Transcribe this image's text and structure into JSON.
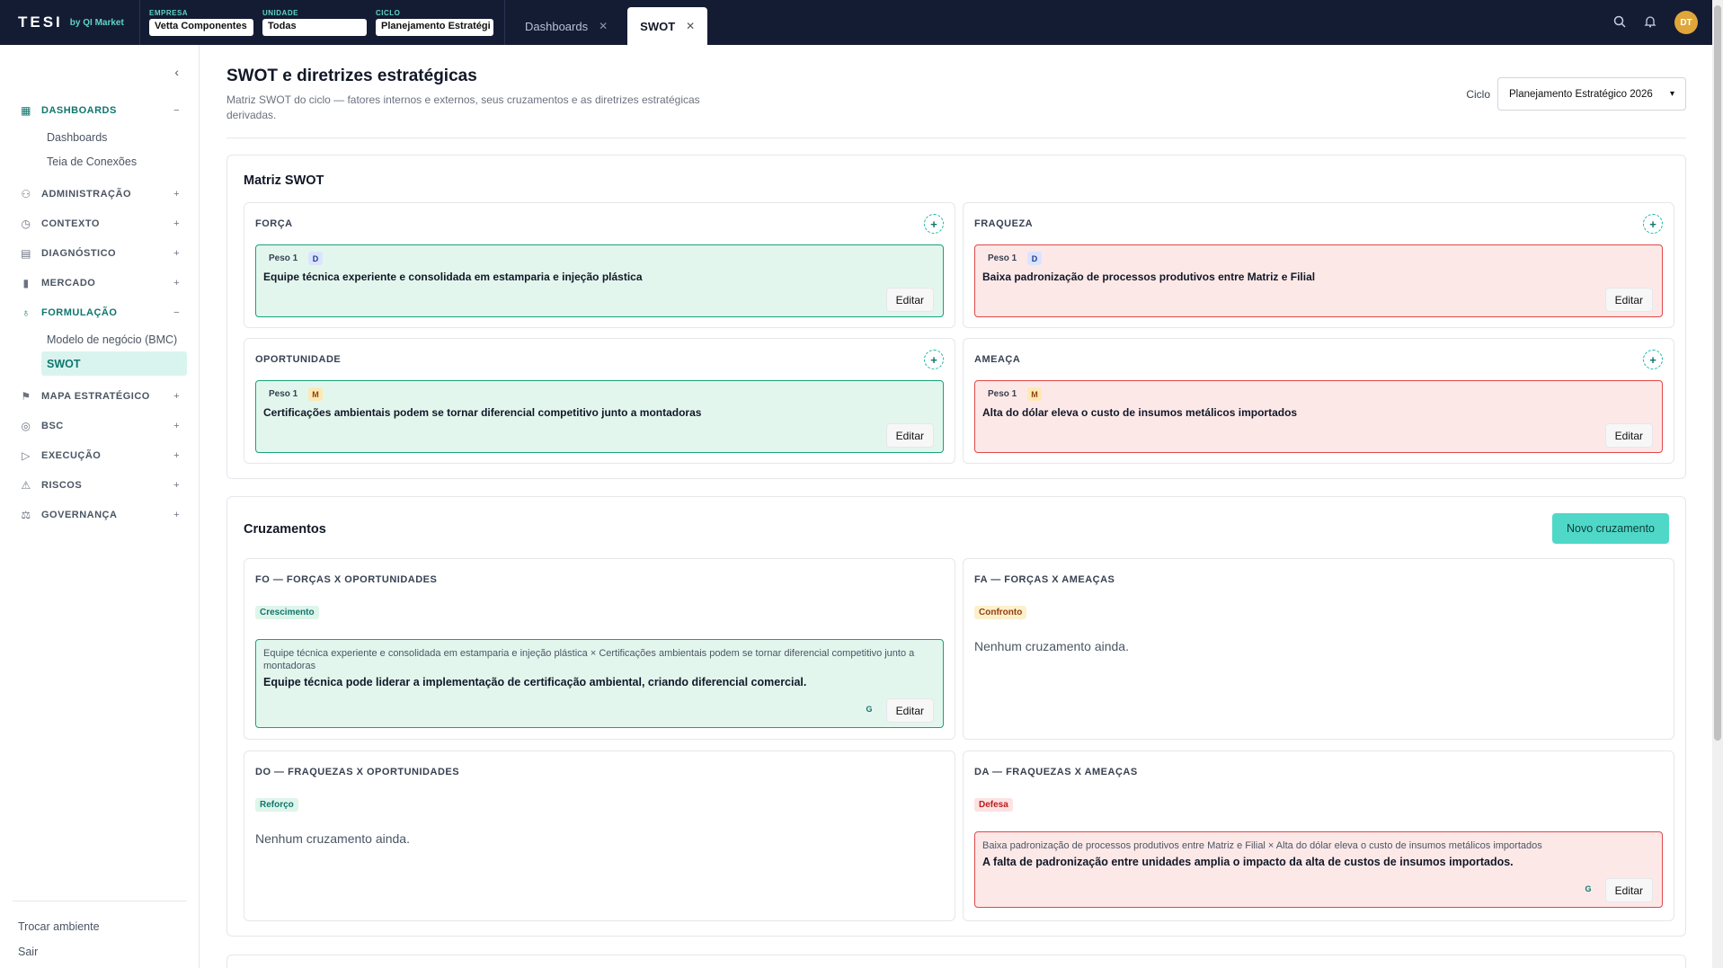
{
  "topbar": {
    "logo": "TESI",
    "logo_sub": "by QI Market",
    "empresa_label": "EMPRESA",
    "empresa_value": "Vetta Componentes",
    "unidade_label": "UNIDADE",
    "unidade_value": "Todas",
    "ciclo_label": "CICLO",
    "ciclo_value": "Planejamento Estratégi",
    "tabs": [
      {
        "label": "Dashboards",
        "active": false
      },
      {
        "label": "SWOT",
        "active": true
      }
    ],
    "avatar": "DT"
  },
  "sidebar": {
    "items": [
      {
        "label": "DASHBOARDS",
        "icon": "dashboard-icon",
        "expanded": true,
        "subitems": [
          "Dashboards",
          "Teia de Conexões"
        ]
      },
      {
        "label": "ADMINISTRAÇÃO",
        "icon": "users-icon",
        "expanded": false
      },
      {
        "label": "CONTEXTO",
        "icon": "compass-icon",
        "expanded": false
      },
      {
        "label": "DIAGNÓSTICO",
        "icon": "clipboard-icon",
        "expanded": false
      },
      {
        "label": "MERCADO",
        "icon": "bar-chart-icon",
        "expanded": false
      },
      {
        "label": "FORMULAÇÃO",
        "icon": "lightbulb-icon",
        "expanded": true,
        "subitems": [
          "Modelo de negócio (BMC)",
          "SWOT"
        ]
      },
      {
        "label": "MAPA ESTRATÉGICO",
        "icon": "flag-icon",
        "expanded": false
      },
      {
        "label": "BSC",
        "icon": "target-icon",
        "expanded": false
      },
      {
        "label": "EXECUÇÃO",
        "icon": "play-icon",
        "expanded": false
      },
      {
        "label": "RISCOS",
        "icon": "warning-icon",
        "expanded": false
      },
      {
        "label": "GOVERNANÇA",
        "icon": "scale-icon",
        "expanded": false
      }
    ],
    "bottom": [
      "Trocar ambiente",
      "Sair"
    ]
  },
  "page": {
    "title": "SWOT e diretrizes estratégicas",
    "description": "Matriz SWOT do ciclo — fatores internos e externos, seus cruzamentos e as diretrizes estratégicas derivadas.",
    "cycle_label": "Ciclo",
    "cycle_value": "Planejamento Estratégico 2026"
  },
  "swot": {
    "title": "Matriz SWOT",
    "quadrants": [
      {
        "title": "FORÇA",
        "peso": "Peso 1",
        "badge": "D",
        "text": "Equipe técnica experiente e consolidada em estamparia e injeção plástica",
        "edit": "Editar"
      },
      {
        "title": "FRAQUEZA",
        "peso": "Peso 1",
        "badge": "D",
        "text": "Baixa padronização de processos produtivos entre Matriz e Filial",
        "edit": "Editar"
      },
      {
        "title": "OPORTUNIDADE",
        "peso": "Peso 1",
        "badge": "M",
        "text": "Certificações ambientais podem se tornar diferencial competitivo junto a montadoras",
        "edit": "Editar"
      },
      {
        "title": "AMEAÇA",
        "peso": "Peso 1",
        "badge": "M",
        "text": "Alta do dólar eleva o custo de insumos metálicos importados",
        "edit": "Editar"
      }
    ]
  },
  "cruzamentos": {
    "title": "Cruzamentos",
    "new_button": "Novo cruzamento",
    "empty_text": "Nenhum cruzamento ainda.",
    "blocks": [
      {
        "title": "FO — FORÇAS X OPORTUNIDADES",
        "tag": "Crescimento",
        "source": "Equipe técnica experiente e consolidada em estamparia e injeção plástica × Certificações ambientais podem se tornar diferencial competitivo junto a montadoras",
        "directive": "Equipe técnica pode liderar a implementação de certificação ambiental, criando diferencial comercial.",
        "badge": "G",
        "edit": "Editar"
      },
      {
        "title": "FA — FORÇAS X AMEAÇAS",
        "tag": "Confronto"
      },
      {
        "title": "DO — FRAQUEZAS X OPORTUNIDADES",
        "tag": "Reforço"
      },
      {
        "title": "DA — FRAQUEZAS X AMEAÇAS",
        "tag": "Defesa",
        "source": "Baixa padronização de processos produtivos entre Matriz e Filial × Alta do dólar eleva o custo de insumos metálicos importados",
        "directive": "A falta de padronização entre unidades amplia o impacto da alta de custos de insumos importados.",
        "badge": "G",
        "edit": "Editar"
      }
    ]
  },
  "colors": {
    "topbar": "#141c34",
    "accent": "#4fd8c8",
    "green_bg": "#e3f6ee",
    "red_bg": "#fde8e8"
  }
}
